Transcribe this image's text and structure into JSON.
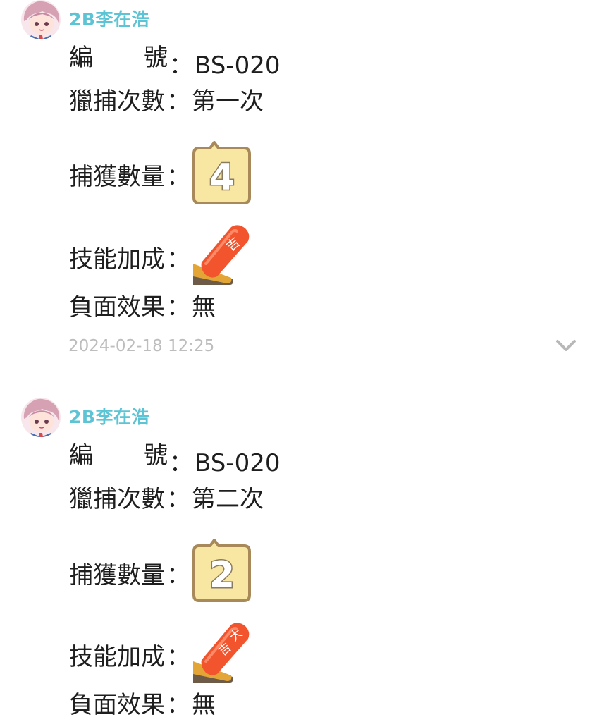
{
  "posts": [
    {
      "username": "2B李在浩",
      "id_label_a": "編",
      "id_label_b": "號",
      "id_value": "BS-020",
      "hunt_label": "獵捕次數",
      "hunt_value": "第一次",
      "catch_label": "捕獲數量",
      "catch_count": "4",
      "skill_label": "技能加成",
      "skill_icon": "omikuji-kichi-icon",
      "skill_chars": "吉",
      "negative_label": "負面效果",
      "negative_value": "無",
      "colon": "：",
      "timestamp": "2024-02-18 12:25"
    },
    {
      "username": "2B李在浩",
      "id_label_a": "編",
      "id_label_b": "號",
      "id_value": "BS-020",
      "hunt_label": "獵捕次數",
      "hunt_value": "第二次",
      "catch_label": "捕獲數量",
      "catch_count": "2",
      "skill_label": "技能加成",
      "skill_icon": "omikuji-daikichi-icon",
      "skill_chars_top": "大",
      "skill_chars_bottom": "吉",
      "negative_label": "負面效果",
      "negative_value": "無",
      "colon": "："
    }
  ],
  "colors": {
    "username": "#5cc4d4",
    "timestamp": "#bdbdbd",
    "badge_fill": "#f8e7a2",
    "badge_border": "#a88a5a",
    "omikuji_red": "#f2542d"
  }
}
